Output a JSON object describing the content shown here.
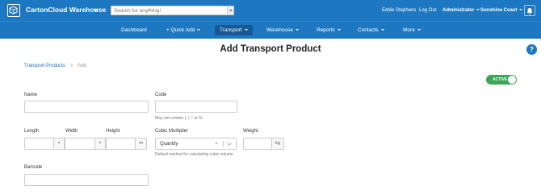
{
  "app": {
    "brand": "CartonCloud Warehouse",
    "search_placeholder": "Search for anything!",
    "user": "Eddie Stephens",
    "logout": "Log Out",
    "role": "Administrator",
    "location": "Sunshine Coast"
  },
  "nav": {
    "dashboard": "Dashboard",
    "quick_add": "+ Quick Add",
    "transport": "Transport",
    "warehouse": "Warehouse",
    "reports": "Reports",
    "contacts": "Contacts",
    "more": "More"
  },
  "page": {
    "title": "Add Transport Product",
    "help": "?"
  },
  "breadcrumb": {
    "parent": "Transport Products",
    "separator": ">",
    "current": "Add"
  },
  "status_toggle": {
    "label": "ACTIVE",
    "on": true
  },
  "form": {
    "name_label": "Name",
    "name_value": "",
    "code_label": "Code",
    "code_value": "",
    "code_hint": "May not contain |, \\, * or %",
    "length_label": "Length",
    "width_label": "Width",
    "height_label": "Height",
    "length_value": "",
    "width_value": "",
    "height_value": "",
    "times_symbol": "×",
    "unit_m": "m",
    "cubic_label": "Cubic Multiplier",
    "cubic_value": "Quantity",
    "cubic_hint": "Default method for calculating cubic volume",
    "clear_symbol": "×",
    "weight_label": "Weight",
    "weight_value": "",
    "unit_kg": "kg",
    "barcode_label": "Barcode",
    "barcode_value": ""
  },
  "colors": {
    "header_blue": "#1d78c1",
    "active_tab": "#155a94",
    "toggle_green": "#3aa655"
  },
  "icons": {
    "logo": "cube-icon",
    "bell": "bell-icon",
    "help": "question-icon"
  }
}
